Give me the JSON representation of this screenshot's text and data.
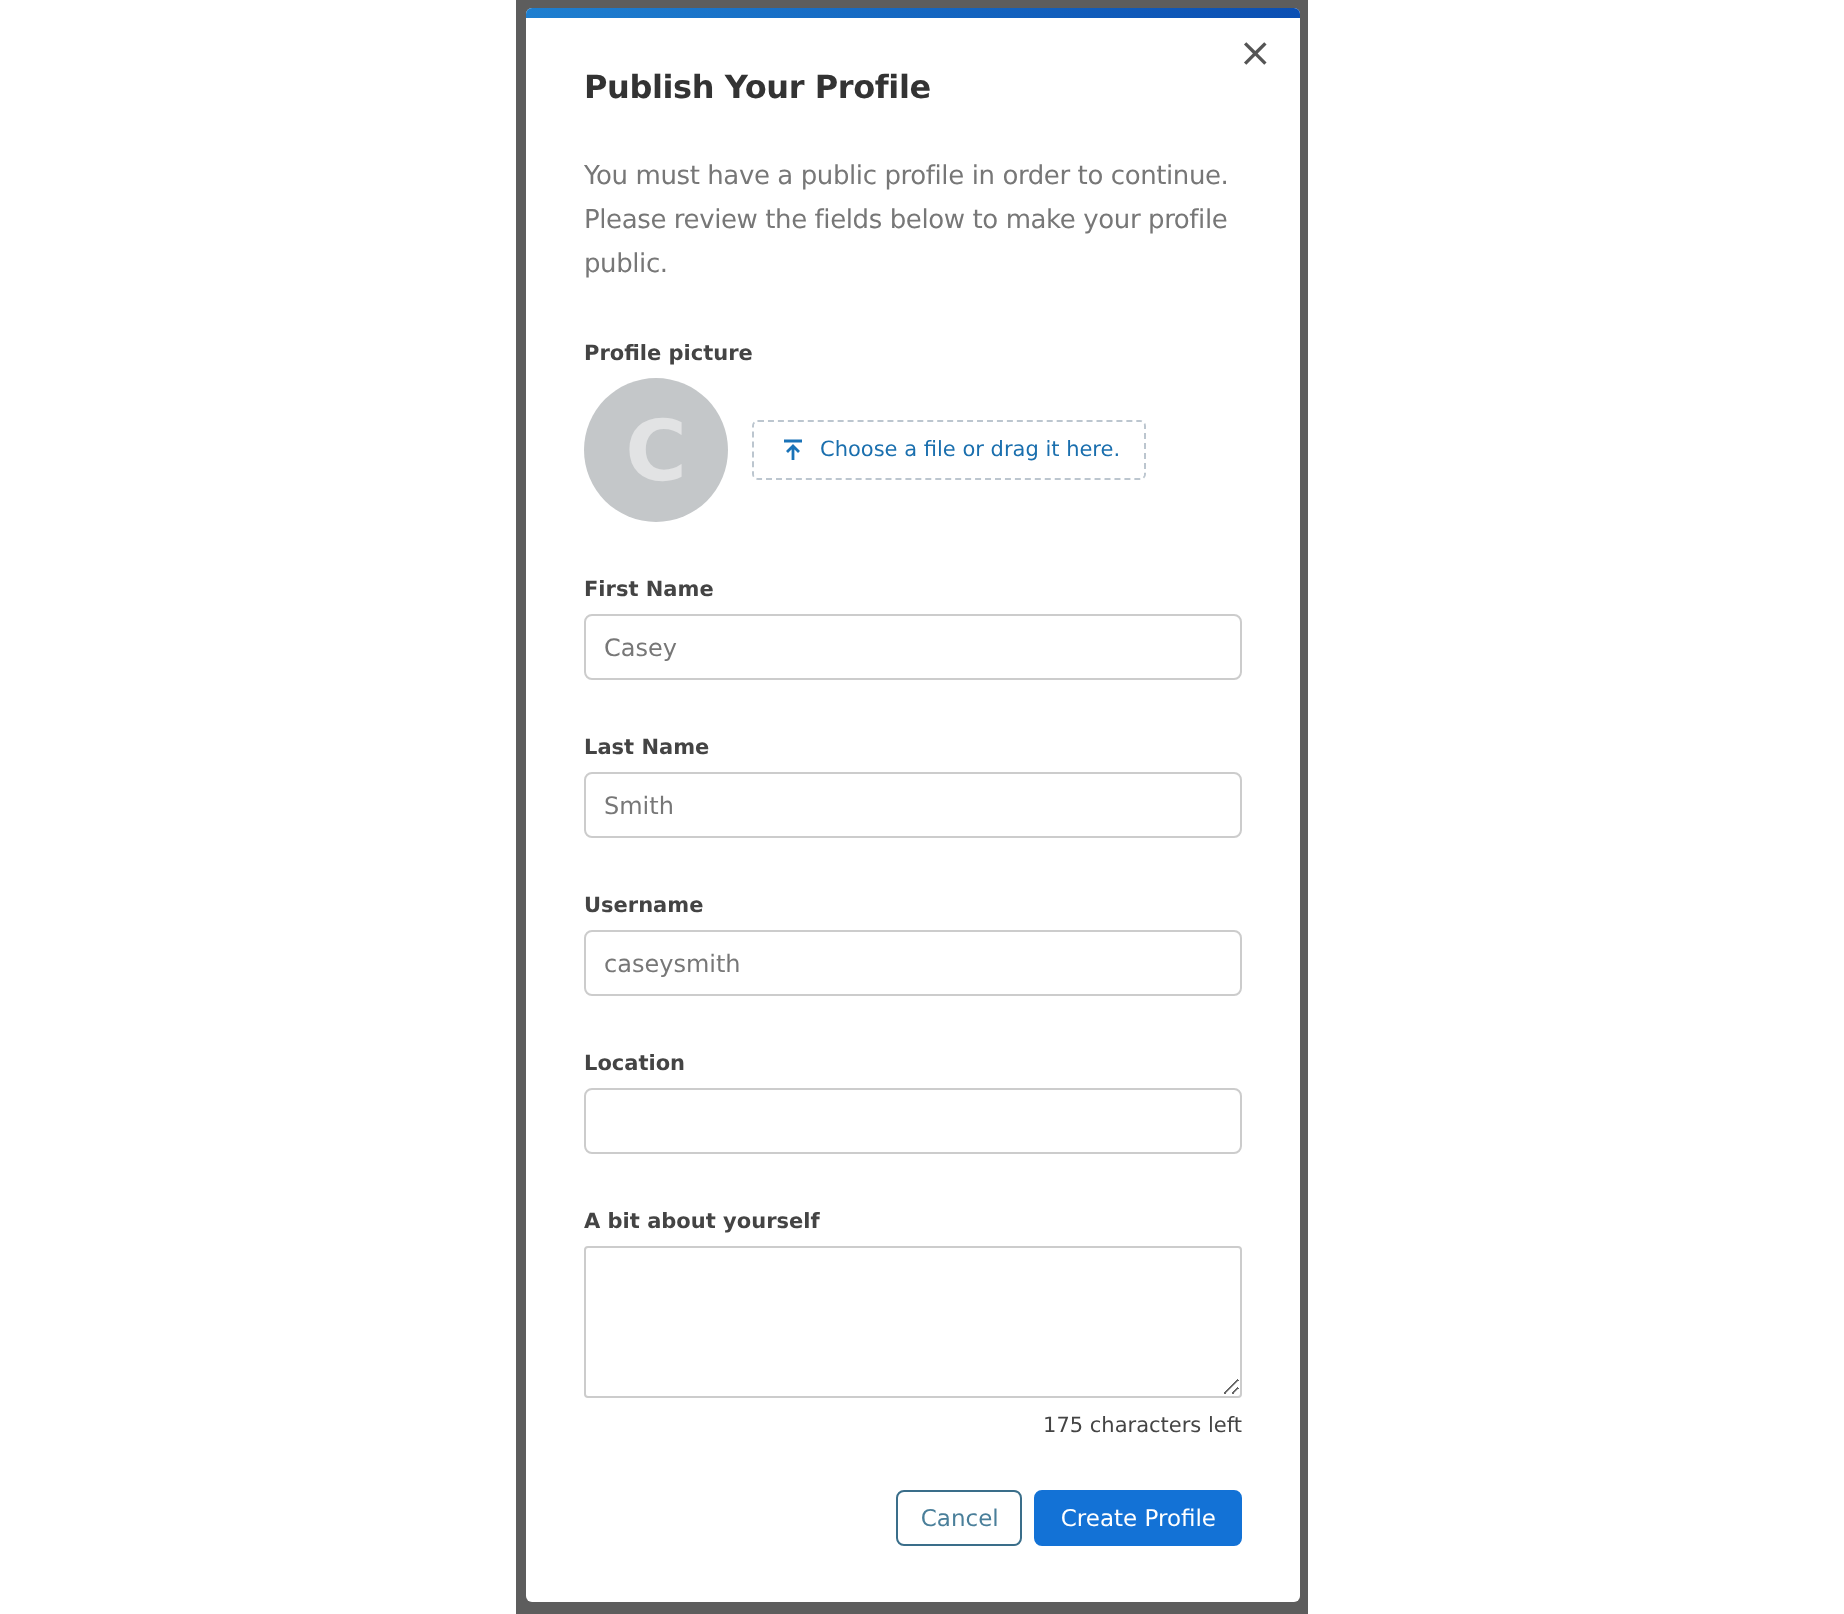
{
  "dialog": {
    "title": "Publish Your Profile",
    "close": "×",
    "intro": "You must have a public profile in order to continue. Please review the fields below to make your profile public."
  },
  "profile_picture": {
    "label": "Profile picture",
    "avatar_letter": "C",
    "upload": "Choose a file or drag it here."
  },
  "fields": [
    {
      "kind": "input",
      "label": "First Name",
      "value": "Casey"
    },
    {
      "kind": "input",
      "label": "Last Name",
      "value": "Smith"
    },
    {
      "kind": "input",
      "label": "Username",
      "value": "caseysmith"
    },
    {
      "kind": "input",
      "label": "Location"
    },
    {
      "kind": "textarea",
      "label": "A bit about yourself",
      "counter": "175 characters left"
    }
  ],
  "buttons": [
    {
      "kind": "secondary",
      "label": "Cancel"
    },
    {
      "kind": "primary",
      "label": "Create Profile"
    }
  ]
}
